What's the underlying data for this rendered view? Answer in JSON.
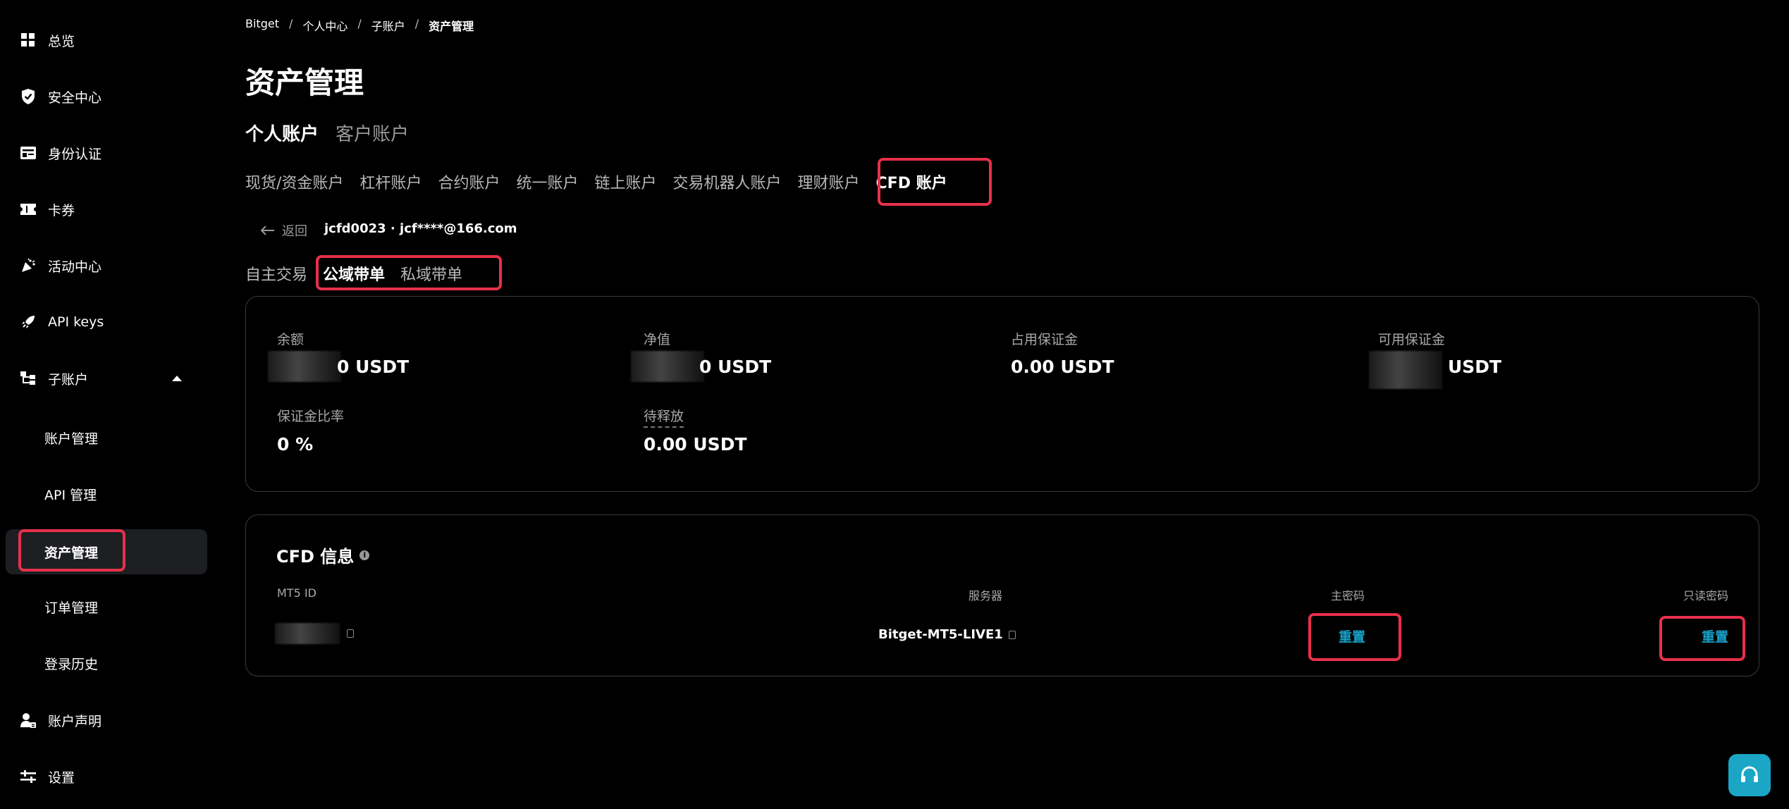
{
  "sidebar": {
    "items": [
      {
        "label": "总览",
        "icon": "grid-icon"
      },
      {
        "label": "安全中心",
        "icon": "shield-icon"
      },
      {
        "label": "身份认证",
        "icon": "id-card-icon"
      },
      {
        "label": "卡券",
        "icon": "ticket-icon"
      },
      {
        "label": "活动中心",
        "icon": "party-icon"
      },
      {
        "label": "API keys",
        "icon": "rocket-icon"
      },
      {
        "label": "子账户",
        "icon": "hierarchy-icon"
      },
      {
        "label": "账户管理"
      },
      {
        "label": "API 管理"
      },
      {
        "label": "资产管理"
      },
      {
        "label": "订单管理"
      },
      {
        "label": "登录历史"
      },
      {
        "label": "账户声明",
        "icon": "user-doc-icon"
      },
      {
        "label": "设置",
        "icon": "sliders-icon"
      }
    ]
  },
  "breadcrumb": [
    "Bitget",
    "个人中心",
    "子账户",
    "资产管理"
  ],
  "breadcrumb_sep": "/",
  "page_title": "资产管理",
  "account_type_tabs": [
    "个人账户",
    "客户账户"
  ],
  "account_tabs": [
    "现货/资金账户",
    "杠杆账户",
    "合约账户",
    "统一账户",
    "链上账户",
    "交易机器人账户",
    "理财账户",
    "CFD 账户"
  ],
  "back_label": "返回",
  "account_line": "jcfd0023 · jcf****@166.com",
  "mode_tabs": [
    "自主交易",
    "公域带单",
    "私域带单"
  ],
  "stats": {
    "balance_label": "余额",
    "balance_value": "0 USDT",
    "net_label": "净值",
    "net_value": "0 USDT",
    "used_margin_label": "占用保证金",
    "used_margin_value": "0.00 USDT",
    "avail_margin_label": "可用保证金",
    "avail_margin_value": "USDT",
    "margin_ratio_label": "保证金比率",
    "margin_ratio_value": "0 %",
    "pending_label": "待释放",
    "pending_value": "0.00 USDT"
  },
  "cfd_info": {
    "title": "CFD 信息",
    "columns": [
      "MT5 ID",
      "服务器",
      "主密码",
      "只读密码"
    ],
    "server": "Bitget-MT5-LIVE1",
    "main_pwd_action": "重置",
    "readonly_pwd_action": "重置"
  },
  "colors": {
    "accent": "#18a3c9",
    "highlight": "#e8304a"
  }
}
